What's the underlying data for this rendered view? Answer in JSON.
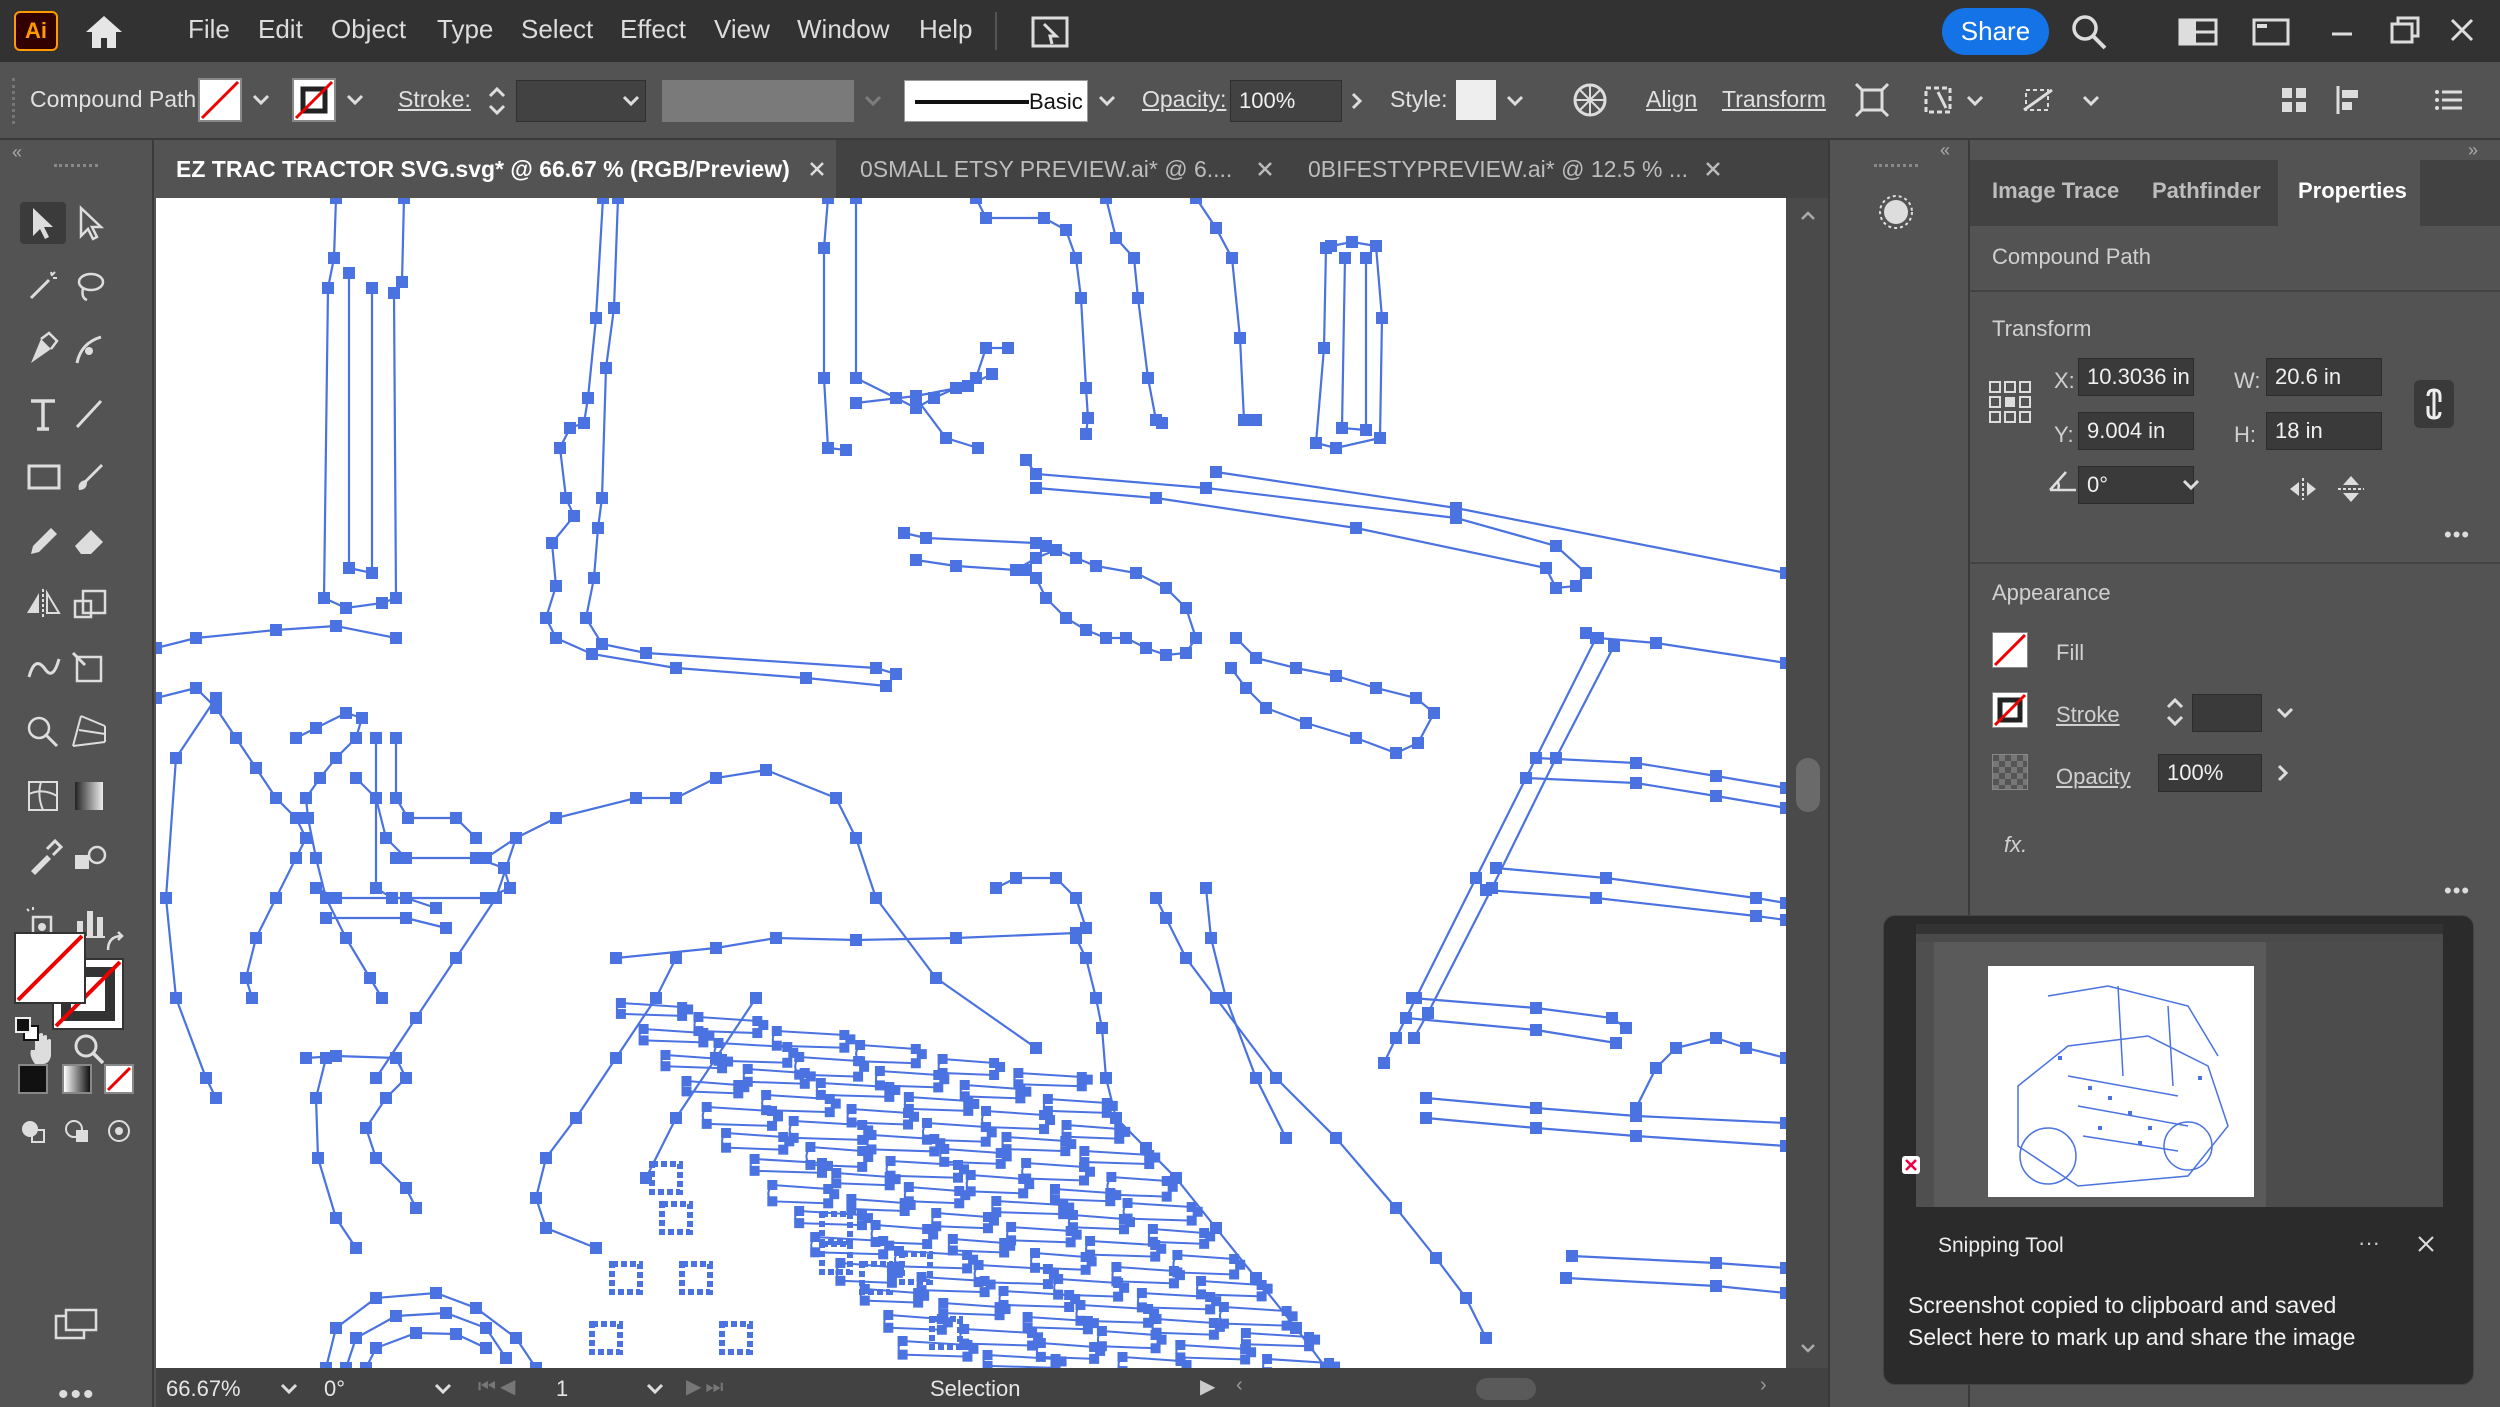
{
  "menubar": {
    "app_logo": "Ai",
    "items": [
      "File",
      "Edit",
      "Object",
      "Type",
      "Select",
      "Effect",
      "View",
      "Window",
      "Help"
    ],
    "share_label": "Share"
  },
  "controlbar": {
    "selection_type": "Compound Path",
    "stroke_label": "Stroke:",
    "brush_label": "Basic",
    "opacity_label": "Opacity:",
    "opacity_value": "100%",
    "style_label": "Style:",
    "align_label": "Align",
    "transform_label": "Transform"
  },
  "tabs": [
    {
      "label": "EZ TRAC TRACTOR SVG.svg* @ 66.67 % (RGB/Preview)",
      "active": true
    },
    {
      "label": "0SMALL ETSY PREVIEW.ai* @ 6....",
      "active": false
    },
    {
      "label": "0BIFESTYPREVIEW.ai* @ 12.5 % ...",
      "active": false
    }
  ],
  "statusbar": {
    "zoom": "66.67%",
    "rotation": "0°",
    "artboard": "1",
    "tool": "Selection"
  },
  "panel": {
    "tabs": [
      "Image Trace",
      "Pathfinder",
      "Properties"
    ],
    "active_tab": "Properties",
    "object_type": "Compound Path",
    "transform_title": "Transform",
    "x_label": "X:",
    "x_value": "10.3036 in",
    "y_label": "Y:",
    "y_value": "9.004 in",
    "w_label": "W:",
    "w_value": "20.6 in",
    "h_label": "H:",
    "h_value": "18 in",
    "angle_value": "0°",
    "appearance_title": "Appearance",
    "fill_label": "Fill",
    "stroke_label": "Stroke",
    "opacity_label": "Opacity",
    "opacity_value": "100%",
    "fx_label": "fx."
  },
  "snipping": {
    "app_name": "Snipping Tool",
    "more": "···",
    "message_line1": "Screenshot copied to clipboard and saved",
    "message_line2": "Select here to mark up and share the image"
  },
  "colors": {
    "path_blue": "#4a72e0",
    "accent": "#1473e6",
    "logo_orange": "#ff9a00"
  }
}
